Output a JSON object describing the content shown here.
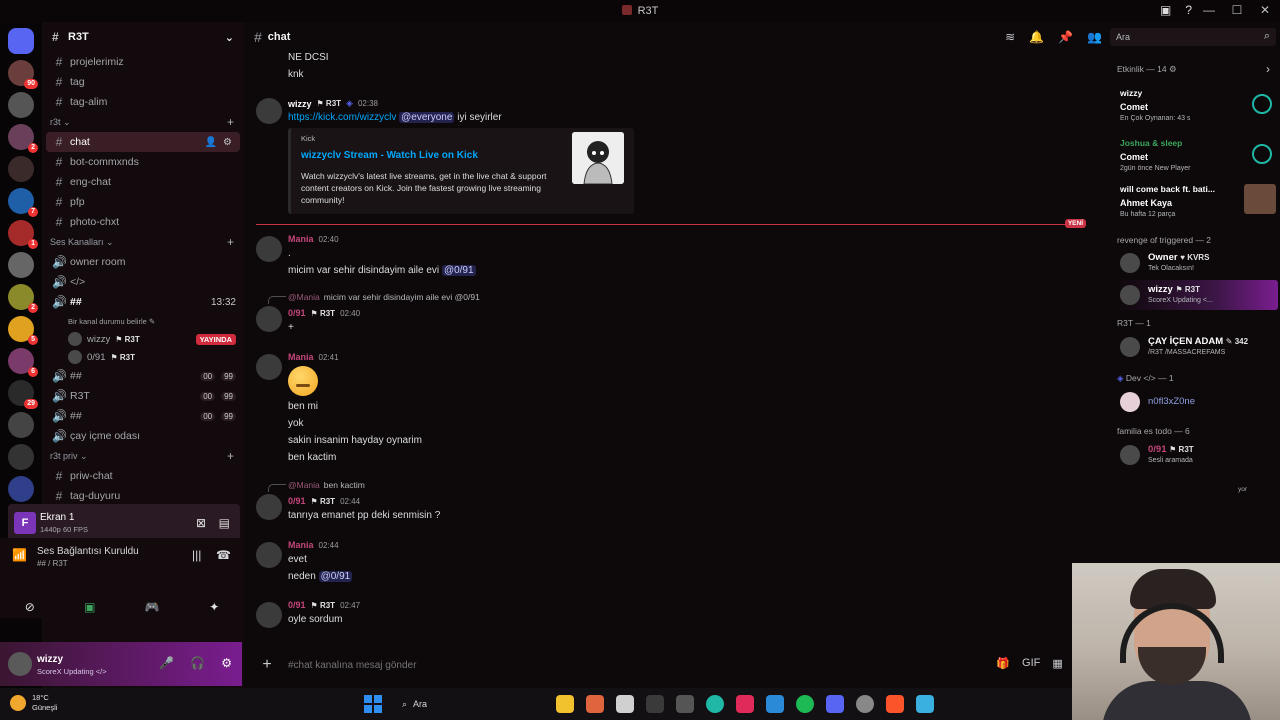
{
  "window": {
    "title": "R3T",
    "controls": [
      "—",
      "☐",
      "✕"
    ],
    "top_icons": [
      "screen-share-icon",
      "help-icon"
    ]
  },
  "servers": [
    {
      "name": "discord-home",
      "color": "#5865f2",
      "badge": "",
      "glyph": "◉"
    },
    {
      "name": "server-1",
      "color": "#6b3e3e",
      "badge": "90"
    },
    {
      "name": "server-2",
      "color": "#555",
      "badge": ""
    },
    {
      "name": "server-3",
      "color": "#6a3f5a",
      "badge": "2"
    },
    {
      "name": "server-4",
      "color": "#3a2a2a",
      "badge": ""
    },
    {
      "name": "server-5",
      "color": "#1f5fa8",
      "badge": "7"
    },
    {
      "name": "server-6",
      "color": "#a52a2a",
      "badge": "1"
    },
    {
      "name": "server-7",
      "color": "#666",
      "badge": ""
    },
    {
      "name": "server-8",
      "color": "#8a8a2a",
      "badge": "2"
    },
    {
      "name": "server-9",
      "color": "#e0a020",
      "badge": "5"
    },
    {
      "name": "server-10",
      "color": "#7a3a6a",
      "badge": "6"
    },
    {
      "name": "server-11",
      "color": "#2a2a2a",
      "badge": "29"
    },
    {
      "name": "server-12",
      "color": "#444",
      "badge": ""
    },
    {
      "name": "server-13",
      "color": "#333",
      "badge": ""
    },
    {
      "name": "server-14",
      "color": "#2f3f8a",
      "badge": ""
    },
    {
      "name": "server-15",
      "color": "#9a9a9a",
      "badge": ""
    },
    {
      "name": "server-16",
      "color": "#1f8fd0",
      "badge": ""
    },
    {
      "name": "server-17",
      "color": "#d0302a",
      "badge": ""
    }
  ],
  "rail_new_badge": "YENİ",
  "sidebar": {
    "server_name": "R3T",
    "top_channels": [
      "projelerimiz",
      "tag",
      "tag-alim"
    ],
    "category_r3t": "r3t",
    "text_channels": [
      {
        "name": "chat",
        "active": true
      },
      {
        "name": "bot-commxnds",
        "active": false
      },
      {
        "name": "eng-chat",
        "active": false
      },
      {
        "name": "pfp",
        "active": false
      },
      {
        "name": "photo-chxt",
        "active": false
      }
    ],
    "category_voice": "Ses Kanalları",
    "voice_channels": [
      {
        "name": "owner room",
        "right": ""
      },
      {
        "name": "</>",
        "right": ""
      }
    ],
    "active_voice": {
      "name": "##",
      "time": "13:32",
      "status_hint": "Bir kanal durumu belirle ✎"
    },
    "voice_users": [
      {
        "name": "wizzy",
        "tag": "R3T",
        "live": "YAYINDA"
      },
      {
        "name": "0/91",
        "tag": "R3T",
        "live": ""
      }
    ],
    "voice_more": [
      {
        "name": "##",
        "c1": "00",
        "c2": "99"
      },
      {
        "name": "R3T",
        "c1": "00",
        "c2": "99"
      },
      {
        "name": "##",
        "c1": "00",
        "c2": "99"
      },
      {
        "name": "çay içme odası",
        "c1": "",
        "c2": ""
      }
    ],
    "category_priv": "r3t priv",
    "priv_channels": [
      "priw-chat",
      "tag-duyuru"
    ]
  },
  "stream_panel": {
    "letter": "F",
    "title": "Ekran 1",
    "sub": "1440p 60 FPS"
  },
  "voice_status": {
    "title": "Ses Bağlantısı Kuruldu",
    "sub": "## / R3T"
  },
  "user_panel": {
    "name": "wizzy",
    "status": "ScoreX Updating </>"
  },
  "chat": {
    "channel": "chat",
    "input_placeholder": "#chat kanalına mesaj gönder",
    "messages": {
      "top1": "NE DCSI",
      "top2": "knk",
      "wizzy_name": "wizzy",
      "wizzy_tag": "R3T",
      "wizzy_time": "02:38",
      "wizzy_link": "https://kick.com/wizzyclv",
      "wizzy_mention": "@everyone",
      "wizzy_rest": " iyi seyirler",
      "embed_provider": "Kick",
      "embed_title": "wizzyclv Stream - Watch Live on Kick",
      "embed_desc": "Watch wizzyclv's latest live streams, get in the live chat & support content creators on Kick. Join the fastest growing live streaming community!",
      "new_label": "YENİ",
      "m1_name": "Mania",
      "m1_time": "02:40",
      "m1_dot": ".",
      "m1_text": "micim var sehir disindayim aile evi ",
      "m1_mention": "@0/91",
      "r1_reply_name": "@Mania",
      "r1_reply_text": "micim var sehir disindayim aile evi @0/91",
      "r1_name": "0/91",
      "r1_tag": "R3T",
      "r1_time": "02:40",
      "r1_text": "+",
      "m2_name": "Mania",
      "m2_time": "02:41",
      "m2_lines": [
        "ben mi",
        "yok",
        "sakin insanim hayday oynarim",
        "ben kactim"
      ],
      "r2_reply_name": "@Mania",
      "r2_reply_text": "ben kactim",
      "r2_name": "0/91",
      "r2_tag": "R3T",
      "r2_time": "02:44",
      "r2_text": "tanrıya emanet pp deki senmisin ?",
      "m3_name": "Mania",
      "m3_time": "02:44",
      "m3_line1": "evet",
      "m3_line2": "neden ",
      "m3_mention": "@0/91",
      "r3_name": "0/91",
      "r3_tag": "R3T",
      "r3_time": "02:47",
      "r3_text": "oyle sordum"
    }
  },
  "members": {
    "search_placeholder": "Ara",
    "activity_header": "Etkinlik — 14",
    "activities": [
      {
        "name": "wizzy",
        "game": "Comet",
        "small": "En Çok Oynanan: 43 s"
      },
      {
        "name": "Joshua & sleep",
        "game": "Comet",
        "small": "2gün önce  New Player"
      },
      {
        "name": "will come back ft. bati...",
        "game": "Ahmet Kaya",
        "small": "Bu hafta 12 parça"
      }
    ],
    "group1": "revenge of triggered — 2",
    "group1_members": [
      {
        "name": "Owner",
        "tag": "KVRS",
        "status": "Tek Olacaksın!"
      },
      {
        "name": "wizzy",
        "tag": "R3T",
        "status": "ScoreX Updating <..."
      }
    ],
    "group2": "R3T — 1",
    "group2_members": [
      {
        "name": "ÇAY İÇEN ADAM",
        "tag": "342",
        "status": "/R3T /MASSACREFAMS"
      }
    ],
    "group3": "Dev </> — 1",
    "group3_members": [
      {
        "name": "n0fl3xZ0ne",
        "tag": "",
        "status": ""
      }
    ],
    "group4": "familia es todo — 6",
    "group4_members": [
      {
        "name": "0/91",
        "tag": "R3T",
        "status": "Sesli aramada"
      }
    ],
    "typing_hint": "yor"
  },
  "taskbar": {
    "weather_temp": "18°C",
    "weather_desc": "Güneşli",
    "search_label": "Ara"
  }
}
